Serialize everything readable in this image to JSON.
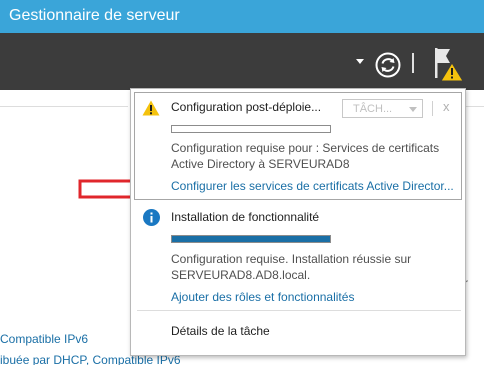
{
  "window": {
    "title": "Gestionnaire de serveur"
  },
  "toolbar": {
    "dropdown_icon": "caret-down-icon",
    "refresh_icon": "refresh-icon",
    "notifications_icon": "flag-warning-icon"
  },
  "background": {
    "left_line1": "Compatible IPv6",
    "left_line2": "ibuée par DHCP, Compatible IPv6",
    "right_frag1": "r",
    "right_frag2": "r"
  },
  "notifications": [
    {
      "icon": "warning-icon",
      "title": "Configuration post-déploie...",
      "task_button": "TÂCH...",
      "close": "x",
      "progress": 0,
      "message_line1": "Configuration requise pour : Services de certificats",
      "message_line2": "Active Directory à SERVEURAD8",
      "link": "Configurer les services de certificats Active Director..."
    },
    {
      "icon": "info-icon",
      "title": "Installation de fonctionnalité",
      "progress": 1.0,
      "message_line1": "Configuration requise. Installation réussie sur",
      "message_line2": "SERVEURAD8.AD8.local.",
      "link": "Ajouter des rôles et fonctionnalités"
    }
  ],
  "footer": {
    "task_details": "Détails de la tâche"
  },
  "colors": {
    "titlebar": "#3aa5d9",
    "toolbar": "#3c3c3c",
    "link": "#1a6fa6",
    "warning": "#f4c20d",
    "arrow": "#e0262b"
  }
}
